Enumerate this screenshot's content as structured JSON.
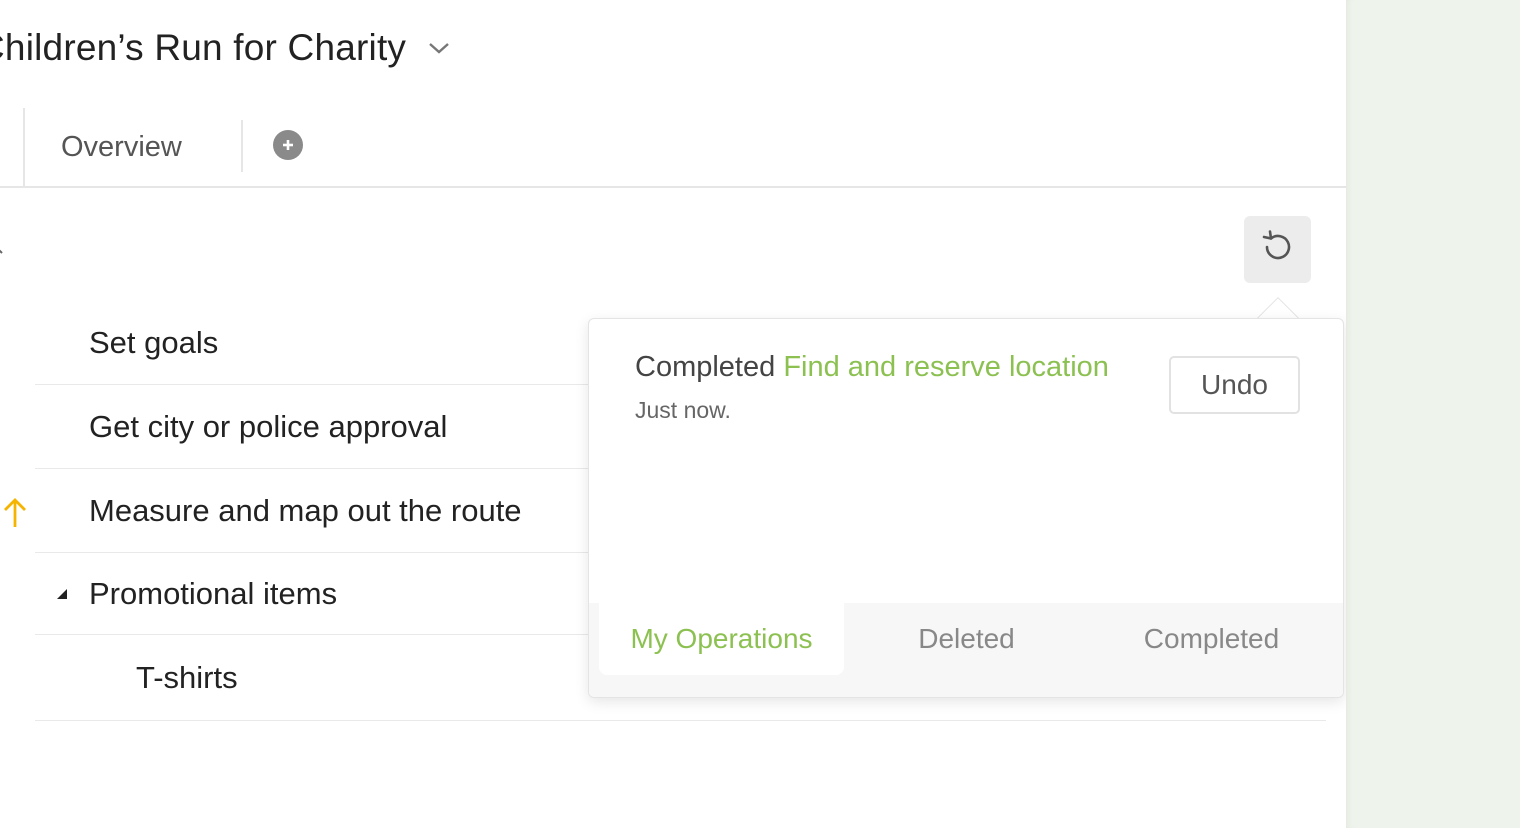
{
  "project": {
    "title": "Children’s Run for Charity"
  },
  "tabs": {
    "overview": "Overview"
  },
  "tasks": [
    {
      "label": "Set goals"
    },
    {
      "label": "Get city or police approval"
    },
    {
      "label": "Measure and map out the route"
    },
    {
      "label": "Promotional items"
    },
    {
      "label": "T-shirts"
    }
  ],
  "history": {
    "entry": {
      "action": "Completed",
      "target": "Find and reserve location",
      "time": "Just now.",
      "undo_label": "Undo"
    },
    "tabs": [
      "My Operations",
      "Deleted",
      "Completed"
    ]
  },
  "colors": {
    "accent": "#8cc152",
    "priority_arrow": "#f5b400",
    "right_rail": "#eef4ec"
  },
  "icons": {
    "title_dropdown": "chevron-down-icon",
    "add_tab": "plus-circle-icon",
    "history": "undo-history-icon",
    "priority": "arrow-up-icon"
  }
}
